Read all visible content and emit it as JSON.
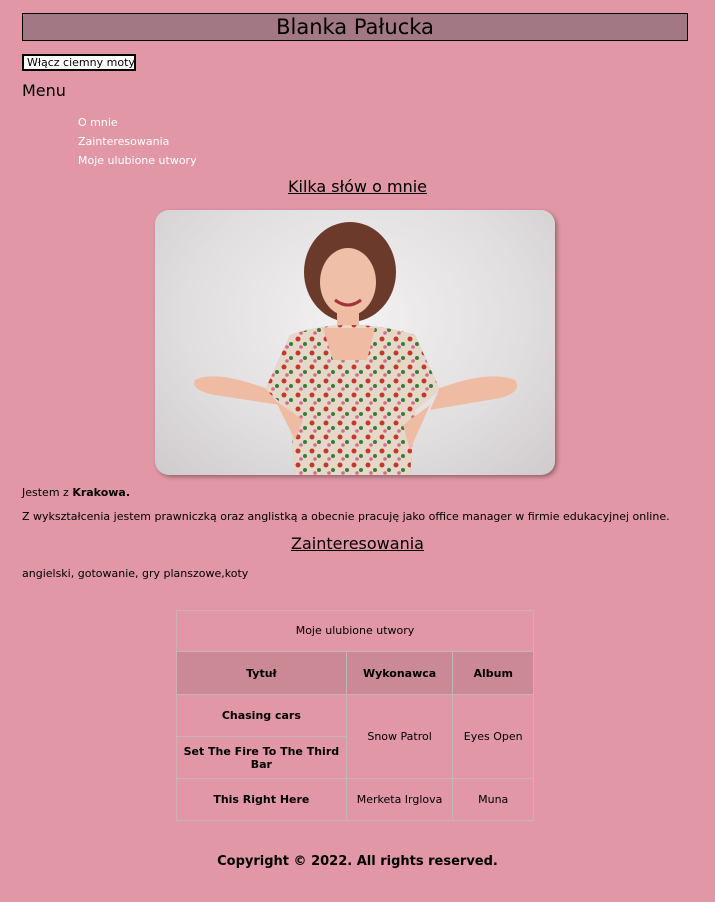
{
  "header": {
    "title": "Blanka Pałucka"
  },
  "theme_button": {
    "label": "Włącz ciemny motyw"
  },
  "menu": {
    "title": "Menu",
    "items": [
      "O mnie",
      "Zainteresowania",
      "Moje ulubione utwory"
    ]
  },
  "about": {
    "title": "Kilka słów o mnie",
    "city_prefix": "Jestem z ",
    "city": "Krakowa.",
    "bio": "Z wykształcenia jestem prawniczką oraz anglistką a obecnie pracuję jako office manager w firmie edukacyjnej online."
  },
  "interests": {
    "title": "Zainteresowania",
    "text": "angielski, gotowanie, gry planszowe,koty"
  },
  "songs": {
    "caption": "Moje ulubione utwory",
    "headers": [
      "Tytuł",
      "Wykonawca",
      "Album"
    ],
    "rows": [
      {
        "title": "Chasing cars",
        "artist": "Snow Patrol",
        "album": "Eyes Open"
      },
      {
        "title": "Set The Fire To The Third Bar",
        "artist": "Snow Patrol",
        "album": "Eyes Open"
      },
      {
        "title": "This Right Here",
        "artist": "Merketa Irglova",
        "album": "Muna"
      }
    ]
  },
  "footer": {
    "text": "Copyright © 2022. All rights reserved."
  },
  "colors": {
    "background": "#e197a5",
    "header": "#a17883",
    "table_head": "#cb8995"
  }
}
